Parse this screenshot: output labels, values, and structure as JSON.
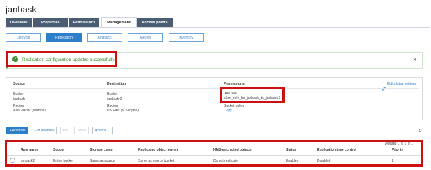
{
  "bucket": {
    "title": "janbask"
  },
  "top_tabs": [
    "Overview",
    "Properties",
    "Permissions",
    "Management",
    "Access points"
  ],
  "sub_tabs": [
    "Lifecycle",
    "Replication",
    "Analytics",
    "Metrics",
    "Inventory"
  ],
  "alert": {
    "message": "Replication configuration updated successfully."
  },
  "replication": {
    "source_header": "Source",
    "destination_header": "Destination",
    "permissions_header": "Permissions",
    "edit_global_settings": "Edit global settings",
    "source": {
      "bucket_label": "Bucket",
      "bucket_value": "janbask",
      "region_label": "Region",
      "region_value": "Asia Pacific (Mumbai)"
    },
    "destination": {
      "bucket_label": "Bucket",
      "bucket_value": "janbask-2",
      "region_label": "Region",
      "region_value": "US East (N. Virginia)"
    },
    "permissions": {
      "iam_label": "IAM role",
      "iam_value": "s3crr_role_for_janbask_to_janbask-2",
      "policy_label": "Bucket policy",
      "copy_link": "Copy"
    }
  },
  "toolbar": {
    "add_rule": "+ Add rule",
    "edit_priorities": "Edit priorities",
    "edit": "Edit",
    "delete": "Delete",
    "actions": "Actions ⌄"
  },
  "viewing": "Viewing 1 to 1 of 1",
  "table": {
    "headers": [
      "Rule name",
      "Scope",
      "Storage class",
      "Replicated object owner",
      "KMS-encrypted objects",
      "Status",
      "Replication time control",
      "Priority"
    ],
    "rows": [
      [
        "janbask2",
        "Entire bucket",
        "Same as source",
        "Same as source bucket",
        "Do not replicate",
        "Enabled",
        "Disabled",
        "1"
      ]
    ]
  },
  "colors": {
    "accent": "#2e7fc9",
    "success": "#3c8a2e",
    "highlight": "#cc1111",
    "tab_bg": "#4a5d73"
  }
}
